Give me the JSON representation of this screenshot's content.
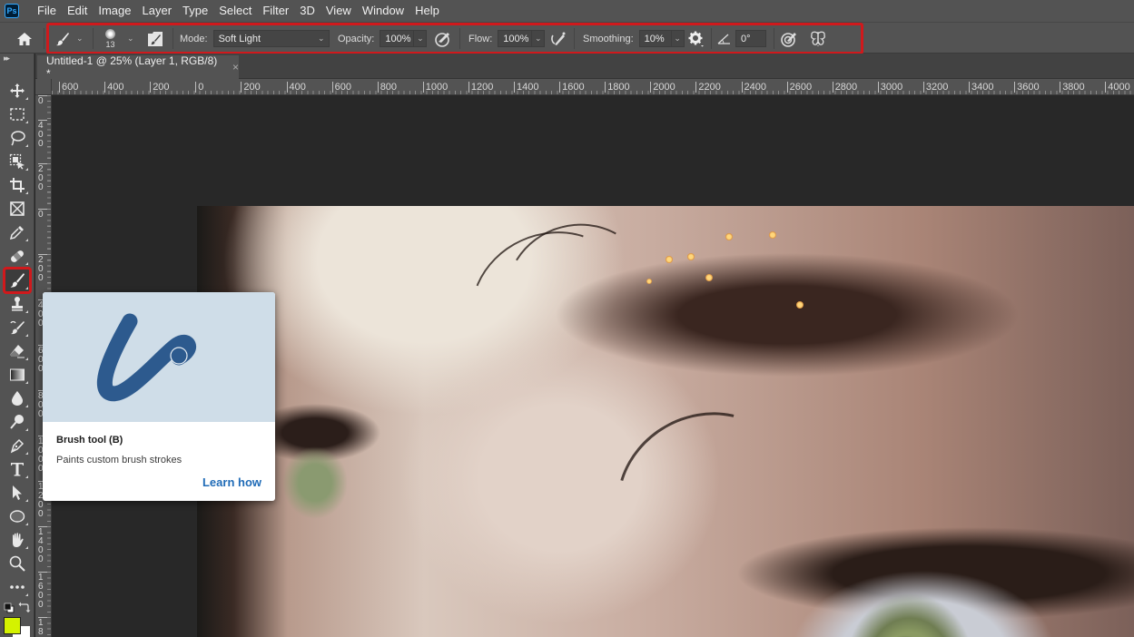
{
  "app": {
    "logo_text": "Ps",
    "menu": [
      "File",
      "Edit",
      "Image",
      "Layer",
      "Type",
      "Select",
      "Filter",
      "3D",
      "View",
      "Window",
      "Help"
    ]
  },
  "options_bar": {
    "brush_size": "13",
    "mode_label": "Mode:",
    "mode_value": "Soft Light",
    "opacity_label": "Opacity:",
    "opacity_value": "100%",
    "flow_label": "Flow:",
    "flow_value": "100%",
    "smoothing_label": "Smoothing:",
    "smoothing_value": "10%",
    "angle_value": "0°",
    "highlight_color": "#d0191c"
  },
  "document": {
    "tab_title": "Untitled-1 @ 25% (Layer 1, RGB/8) *",
    "close_glyph": "×"
  },
  "rulers": {
    "horizontal": [
      "600",
      "400",
      "200",
      "0",
      "200",
      "400",
      "600",
      "800",
      "1000",
      "1200",
      "1400",
      "1600",
      "1800",
      "2000",
      "2200",
      "2400",
      "2600",
      "2800",
      "3000",
      "3200",
      "3400",
      "3600",
      "3800",
      "4000"
    ],
    "vertical": [
      "0",
      "400",
      "200",
      "0",
      "200",
      "400",
      "600",
      "800",
      "1000",
      "1200",
      "1400",
      "1600",
      "18"
    ]
  },
  "toolbar": {
    "tools": [
      {
        "name": "move-tool",
        "label": "Move"
      },
      {
        "name": "marquee-tool",
        "label": "Rectangular Marquee"
      },
      {
        "name": "lasso-tool",
        "label": "Lasso"
      },
      {
        "name": "object-selection-tool",
        "label": "Object Selection"
      },
      {
        "name": "crop-tool",
        "label": "Crop"
      },
      {
        "name": "frame-tool",
        "label": "Frame"
      },
      {
        "name": "eyedropper-tool",
        "label": "Eyedropper"
      },
      {
        "name": "healing-brush-tool",
        "label": "Spot Healing Brush"
      },
      {
        "name": "brush-tool",
        "label": "Brush",
        "active": true
      },
      {
        "name": "clone-stamp-tool",
        "label": "Clone Stamp"
      },
      {
        "name": "history-brush-tool",
        "label": "History Brush"
      },
      {
        "name": "eraser-tool",
        "label": "Eraser"
      },
      {
        "name": "gradient-tool",
        "label": "Gradient"
      },
      {
        "name": "blur-tool",
        "label": "Blur"
      },
      {
        "name": "dodge-tool",
        "label": "Dodge"
      },
      {
        "name": "pen-tool",
        "label": "Pen"
      },
      {
        "name": "type-tool",
        "label": "Type"
      },
      {
        "name": "path-selection-tool",
        "label": "Path Selection"
      },
      {
        "name": "ellipse-tool",
        "label": "Ellipse"
      },
      {
        "name": "hand-tool",
        "label": "Hand"
      },
      {
        "name": "zoom-tool",
        "label": "Zoom"
      },
      {
        "name": "edit-toolbar",
        "label": "Edit Toolbar"
      }
    ],
    "foreground_color": "#d4f200",
    "background_color": "#ffffff"
  },
  "tooltip": {
    "title": "Brush tool (B)",
    "description": "Paints custom brush strokes",
    "link": "Learn how",
    "image_bg": "#cfdde8",
    "stroke_color": "#2d5a8e"
  }
}
